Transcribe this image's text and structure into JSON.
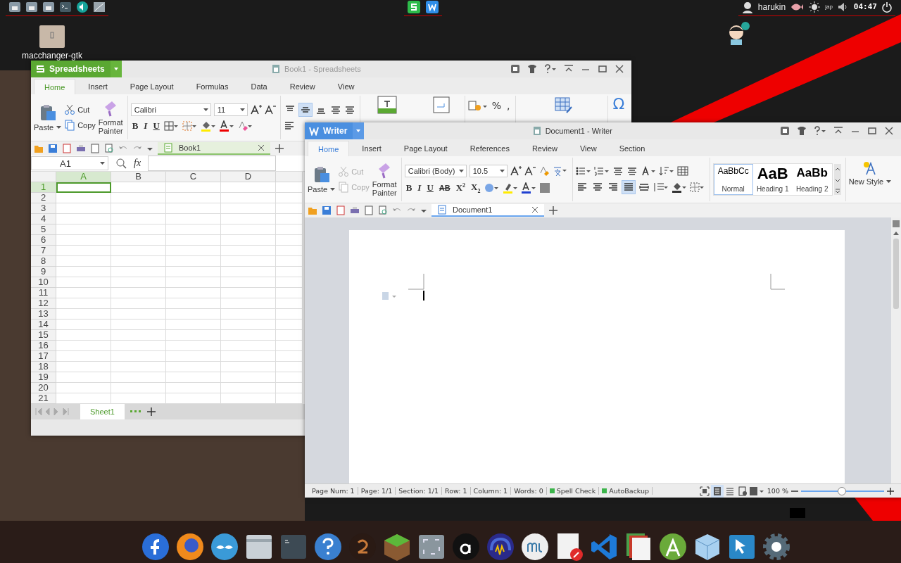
{
  "top_panel": {
    "user": "harukin",
    "keyboard_layout": "jap",
    "clock": "04:47"
  },
  "desktop_icons": [
    {
      "label": "macchanger-gtk"
    }
  ],
  "spreadsheet_window": {
    "app_name": "Spreadsheets",
    "title": "Book1 - Spreadsheets",
    "tabs": [
      {
        "label": "Home",
        "selected": true
      },
      {
        "label": "Insert",
        "selected": false
      },
      {
        "label": "Page Layout",
        "selected": false
      },
      {
        "label": "Formulas",
        "selected": false
      },
      {
        "label": "Data",
        "selected": false
      },
      {
        "label": "Review",
        "selected": false
      },
      {
        "label": "View",
        "selected": false
      }
    ],
    "clipboard": {
      "paste": "Paste",
      "cut": "Cut",
      "copy": "Copy",
      "format_painter": "Format Painter",
      "cut_disabled": false,
      "copy_disabled": false
    },
    "font": "Calibri",
    "font_size": "11",
    "format_buttons": [
      "B",
      "I",
      "U"
    ],
    "align_buttons": [
      {
        "kind": "top",
        "selected": false
      },
      {
        "kind": "middle",
        "selected": true
      },
      {
        "kind": "bottom",
        "selected": false
      }
    ],
    "number_buttons": [
      "%",
      ","
    ],
    "symbol": "Ω",
    "doc_tabs": [
      {
        "label": "Book1",
        "selected": true
      }
    ],
    "name_box": "A1",
    "formula_label": "fx",
    "columns": [
      {
        "label": "A",
        "selected": true
      },
      {
        "label": "B",
        "selected": false
      },
      {
        "label": "C",
        "selected": false
      },
      {
        "label": "D",
        "selected": false
      }
    ],
    "rows": [
      {
        "label": "1",
        "selected": true
      },
      {
        "label": "2",
        "selected": false
      },
      {
        "label": "3",
        "selected": false
      },
      {
        "label": "4",
        "selected": false
      },
      {
        "label": "5",
        "selected": false
      },
      {
        "label": "6",
        "selected": false
      },
      {
        "label": "7",
        "selected": false
      },
      {
        "label": "8",
        "selected": false
      },
      {
        "label": "9",
        "selected": false
      },
      {
        "label": "10",
        "selected": false
      },
      {
        "label": "11",
        "selected": false
      },
      {
        "label": "12",
        "selected": false
      },
      {
        "label": "13",
        "selected": false
      },
      {
        "label": "14",
        "selected": false
      },
      {
        "label": "15",
        "selected": false
      },
      {
        "label": "16",
        "selected": false
      },
      {
        "label": "17",
        "selected": false
      },
      {
        "label": "18",
        "selected": false
      },
      {
        "label": "19",
        "selected": false
      },
      {
        "label": "20",
        "selected": false
      },
      {
        "label": "21",
        "selected": false
      }
    ],
    "sheet_tabs": [
      {
        "label": "Sheet1",
        "selected": true
      }
    ]
  },
  "writer_window": {
    "app_name": "Writer",
    "title": "Document1 - Writer",
    "tabs": [
      {
        "label": "Home",
        "selected": true
      },
      {
        "label": "Insert",
        "selected": false
      },
      {
        "label": "Page Layout",
        "selected": false
      },
      {
        "label": "References",
        "selected": false
      },
      {
        "label": "Review",
        "selected": false
      },
      {
        "label": "View",
        "selected": false
      },
      {
        "label": "Section",
        "selected": false
      }
    ],
    "clipboard": {
      "paste": "Paste",
      "cut": "Cut",
      "copy": "Copy",
      "format_painter": "Format Painter",
      "cut_disabled": true,
      "copy_disabled": true
    },
    "font": "Calibri (Body)",
    "font_size": "10.5",
    "format_buttons": [
      "B",
      "I",
      "U",
      "AB",
      "X$^{2}$",
      "X$_{2}$"
    ],
    "align_buttons": [
      {
        "kind": "left",
        "selected": false
      },
      {
        "kind": "center",
        "selected": false
      },
      {
        "kind": "right",
        "selected": false
      },
      {
        "kind": "justify",
        "selected": true
      },
      {
        "kind": "distributed",
        "selected": false
      }
    ],
    "styles": [
      {
        "preview": "AaBbCc",
        "name": "Normal",
        "selected": true
      },
      {
        "preview": "AaB",
        "name": "Heading 1",
        "selected": false
      },
      {
        "preview": "AaBb",
        "name": "Heading 2",
        "selected": false
      }
    ],
    "new_style": "New Style",
    "doc_tabs": [
      {
        "label": "Document1",
        "selected": true
      }
    ],
    "status_items": [
      "Page Num: 1",
      "Page: 1/1",
      "Section: 1/1",
      "Row: 1",
      "Column: 1",
      "Words: 0"
    ],
    "indicators": [
      {
        "label": "Spell Check",
        "on": true
      },
      {
        "label": "AutoBackup",
        "on": true
      }
    ],
    "view_buttons": [
      {
        "kind": "fullscreen",
        "selected": false
      },
      {
        "kind": "page",
        "selected": true
      },
      {
        "kind": "outline",
        "selected": false
      },
      {
        "kind": "web",
        "selected": false
      }
    ],
    "zoom": "100 %",
    "zoom_slider": {
      "level": 0.49
    }
  }
}
